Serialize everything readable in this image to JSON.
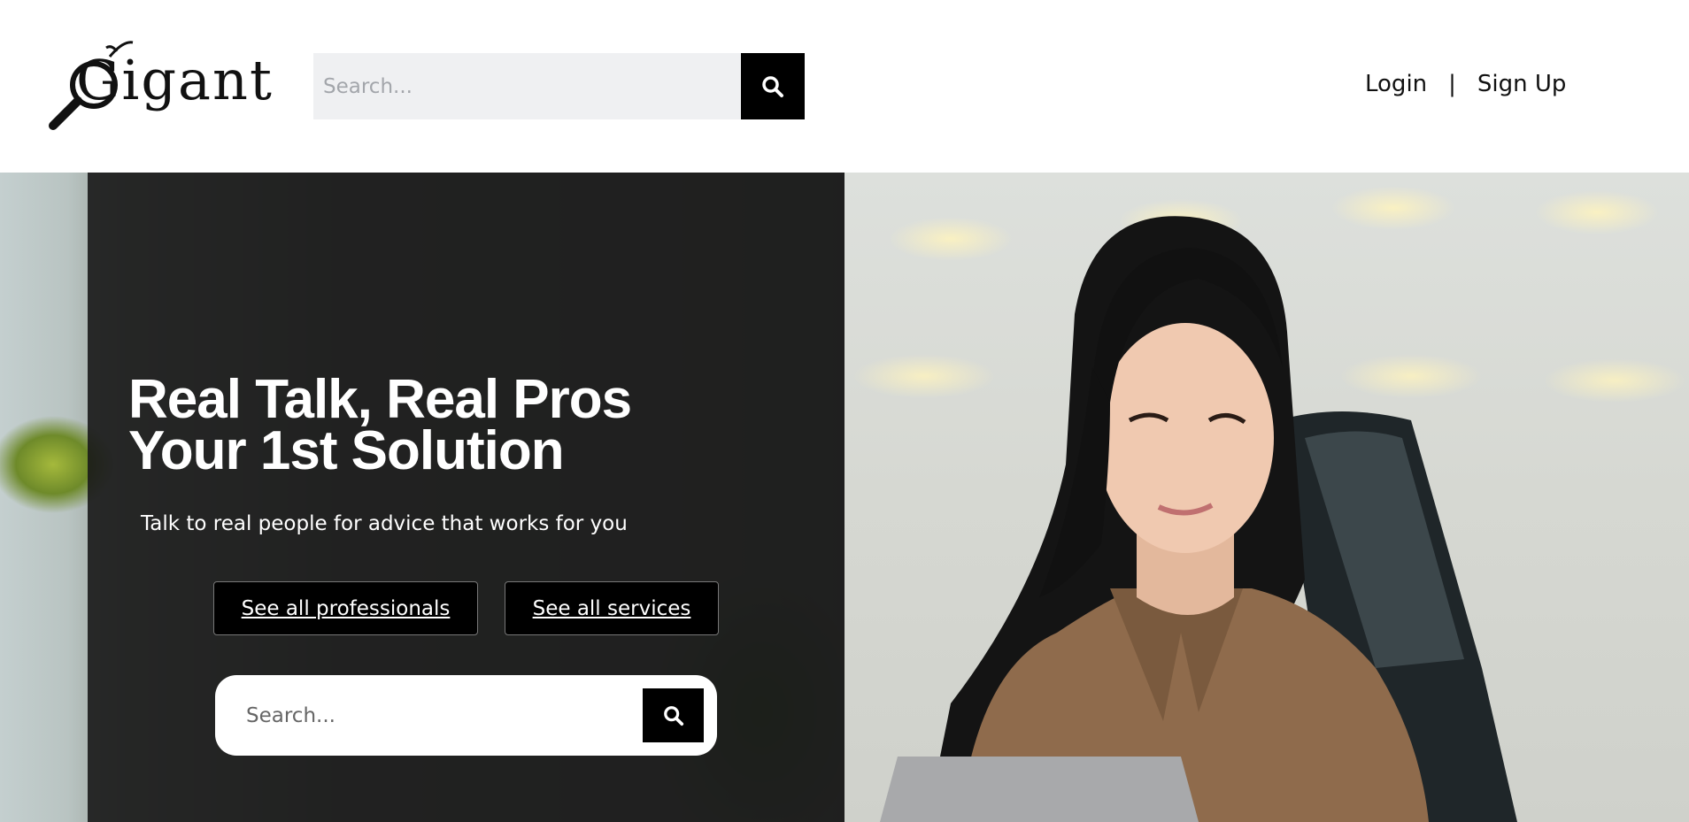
{
  "header": {
    "logo_text": "Gigant",
    "search_placeholder": "Search...",
    "nav": {
      "login": "Login",
      "separator": "|",
      "signup": "Sign Up"
    }
  },
  "hero": {
    "title_line1": "Real Talk, Real Pros",
    "title_line2": "Your 1st Solution",
    "subtitle": "Talk to real people for advice that works for you",
    "buttons": {
      "professionals": "See all professionals",
      "services": "See all services"
    },
    "search_placeholder": "Search..."
  },
  "icons": {
    "search": "search-icon",
    "logo": "magnifier-logo-icon"
  },
  "colors": {
    "accent": "#000000",
    "search_field_bg": "#eff0f2",
    "overlay": "#181818"
  }
}
